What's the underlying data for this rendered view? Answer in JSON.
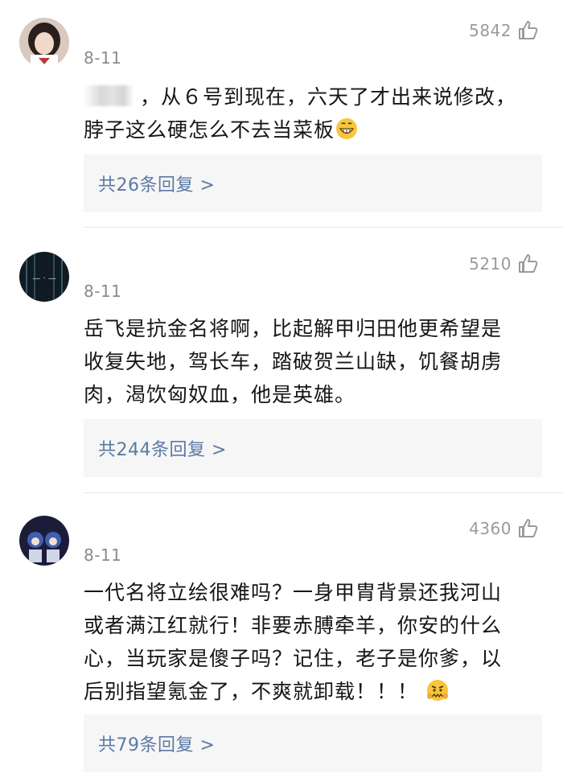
{
  "comments": [
    {
      "date": "8-11",
      "likes": "5842",
      "text_line1": "，从６号到现在，六天了才出来说修改，",
      "text_line2": "脖子这么硬怎么不去当菜板",
      "emoji": "grinning-face-emoji",
      "replies_label": "共26条回复 >"
    },
    {
      "date": "8-11",
      "likes": "5210",
      "text_line1": "岳飞是抗金名将啊，比起解甲归田他更希望是",
      "text_line2": "收复失地，驾长车，踏破贺兰山缺，饥餐胡虏",
      "text_line3": "肉，渴饮匈奴血，他是英雄。",
      "replies_label": "共244条回复 >"
    },
    {
      "date": "8-11",
      "likes": "4360",
      "text_line1": "一代名将立绘很难吗？一身甲胄背景还我河山",
      "text_line2": "或者满江红就行！非要赤膊牵羊，你安的什么",
      "text_line3": "心，当玩家是傻子吗？记住，老子是你爹，以",
      "text_line4": "后别指望氪金了，不爽就卸载！！！",
      "emoji": "angry-face-emoji",
      "replies_label": "共79条回复 >"
    }
  ],
  "colors": {
    "reply_link": "#5a7aa6",
    "reply_bg": "#f6f6f6",
    "meta_gray": "#8a8a8a"
  }
}
